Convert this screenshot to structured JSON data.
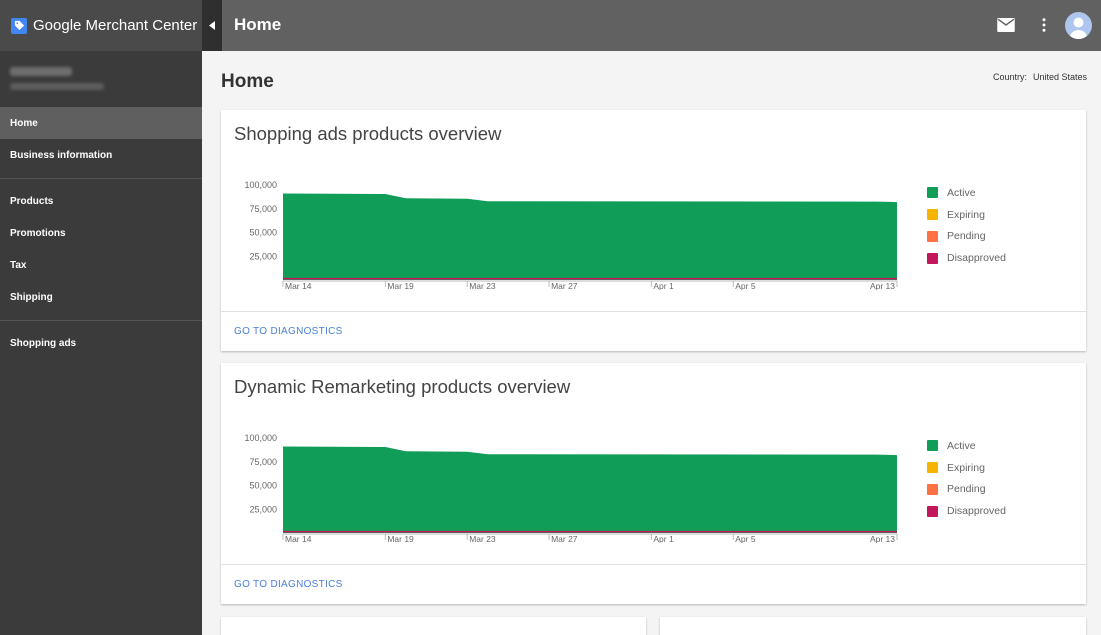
{
  "app": {
    "brand": "Google Merchant Center",
    "page_title": "Home",
    "icons": {
      "logo": "merchant-tag-icon",
      "collapse": "chevron-left-icon",
      "mail": "mail-icon",
      "more": "more-vert-icon",
      "avatar": "account-avatar"
    }
  },
  "sidebar": {
    "items": [
      {
        "label": "Home",
        "active": true
      },
      {
        "label": "Business information"
      },
      {
        "label": "Products"
      },
      {
        "label": "Promotions"
      },
      {
        "label": "Tax"
      },
      {
        "label": "Shipping"
      },
      {
        "label": "Shopping ads"
      }
    ]
  },
  "main": {
    "title": "Home",
    "country_label": "Country:",
    "country_value": "United States"
  },
  "colors": {
    "active": "#0f9d58",
    "expiring": "#f4b400",
    "pending": "#ff7043",
    "disapproved": "#c2185b"
  },
  "cards": [
    {
      "title": "Shopping ads products overview",
      "footer_link": "GO TO DIAGNOSTICS"
    },
    {
      "title": "Dynamic Remarketing products overview",
      "footer_link": "GO TO DIAGNOSTICS"
    }
  ],
  "chart_data": [
    {
      "type": "area",
      "title": "Shopping ads products overview",
      "x_ticks": [
        "Mar 14",
        "Mar 19",
        "Mar 23",
        "Mar 27",
        "Apr 1",
        "Apr 5",
        "Apr 13"
      ],
      "y_ticks": [
        "100,000",
        "75,000",
        "50,000",
        "25,000"
      ],
      "ylim": [
        0,
        100000
      ],
      "x": [
        "Mar 14",
        "Mar 19",
        "Mar 20",
        "Mar 23",
        "Mar 24",
        "Apr 12",
        "Apr 13"
      ],
      "series": [
        {
          "name": "Active",
          "values": [
            91000,
            90500,
            86000,
            85500,
            83000,
            82500,
            82000
          ]
        },
        {
          "name": "Expiring",
          "values": [
            0,
            0,
            0,
            0,
            0,
            0,
            0
          ]
        },
        {
          "name": "Pending",
          "values": [
            0,
            0,
            0,
            0,
            0,
            0,
            0
          ]
        },
        {
          "name": "Disapproved",
          "values": [
            800,
            800,
            800,
            800,
            800,
            800,
            800
          ]
        }
      ],
      "legend": "right"
    },
    {
      "type": "area",
      "title": "Dynamic Remarketing products overview",
      "x_ticks": [
        "Mar 14",
        "Mar 19",
        "Mar 23",
        "Mar 27",
        "Apr 1",
        "Apr 5",
        "Apr 13"
      ],
      "y_ticks": [
        "100,000",
        "75,000",
        "50,000",
        "25,000"
      ],
      "ylim": [
        0,
        100000
      ],
      "x": [
        "Mar 14",
        "Mar 19",
        "Mar 20",
        "Mar 23",
        "Mar 24",
        "Apr 12",
        "Apr 13"
      ],
      "series": [
        {
          "name": "Active",
          "values": [
            91000,
            90500,
            86000,
            85500,
            83000,
            82500,
            82000
          ]
        },
        {
          "name": "Expiring",
          "values": [
            0,
            0,
            0,
            0,
            0,
            0,
            0
          ]
        },
        {
          "name": "Pending",
          "values": [
            0,
            0,
            0,
            0,
            0,
            0,
            0
          ]
        },
        {
          "name": "Disapproved",
          "values": [
            800,
            800,
            800,
            800,
            800,
            800,
            800
          ]
        }
      ],
      "legend": "right"
    }
  ]
}
